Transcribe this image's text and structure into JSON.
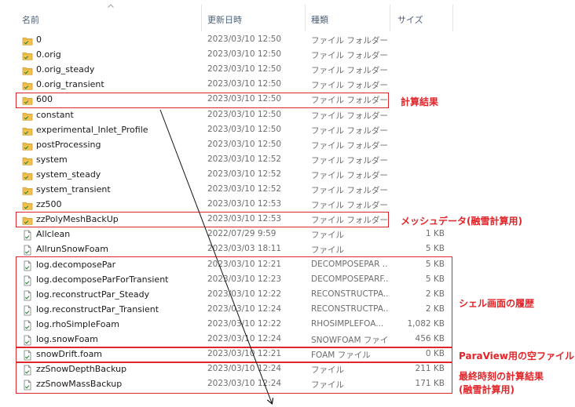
{
  "columns": {
    "name": "名前",
    "modified": "更新日時",
    "type": "種類",
    "size": "サイズ"
  },
  "rows": [
    {
      "icon": "folder-icon",
      "name": "0",
      "date": "2023/03/10 12:50",
      "type": "ファイル フォルダー",
      "size": ""
    },
    {
      "icon": "folder-icon",
      "name": "0.orig",
      "date": "2023/03/10 12:50",
      "type": "ファイル フォルダー",
      "size": ""
    },
    {
      "icon": "folder-icon",
      "name": "0.orig_steady",
      "date": "2023/03/10 12:50",
      "type": "ファイル フォルダー",
      "size": ""
    },
    {
      "icon": "folder-icon",
      "name": "0.orig_transient",
      "date": "2023/03/10 12:50",
      "type": "ファイル フォルダー",
      "size": ""
    },
    {
      "icon": "folder-icon",
      "name": "600",
      "date": "2023/03/10 12:50",
      "type": "ファイル フォルダー",
      "size": ""
    },
    {
      "icon": "folder-icon",
      "name": "constant",
      "date": "2023/03/10 12:50",
      "type": "ファイル フォルダー",
      "size": ""
    },
    {
      "icon": "folder-icon",
      "name": "experimental_Inlet_Profile",
      "date": "2023/03/10 12:50",
      "type": "ファイル フォルダー",
      "size": ""
    },
    {
      "icon": "folder-icon",
      "name": "postProcessing",
      "date": "2023/03/10 12:50",
      "type": "ファイル フォルダー",
      "size": ""
    },
    {
      "icon": "folder-icon",
      "name": "system",
      "date": "2023/03/10 12:52",
      "type": "ファイル フォルダー",
      "size": ""
    },
    {
      "icon": "folder-icon",
      "name": "system_steady",
      "date": "2023/03/10 12:52",
      "type": "ファイル フォルダー",
      "size": ""
    },
    {
      "icon": "folder-icon",
      "name": "system_transient",
      "date": "2023/03/10 12:52",
      "type": "ファイル フォルダー",
      "size": ""
    },
    {
      "icon": "folder-icon",
      "name": "zz500",
      "date": "2023/03/10 12:53",
      "type": "ファイル フォルダー",
      "size": ""
    },
    {
      "icon": "folder-icon",
      "name": "zzPolyMeshBackUp",
      "date": "2023/03/10 12:53",
      "type": "ファイル フォルダー",
      "size": ""
    },
    {
      "icon": "file-icon",
      "name": "Allclean",
      "date": "2022/07/29 9:59",
      "type": "ファイル",
      "size": "1 KB"
    },
    {
      "icon": "file-icon",
      "name": "AllrunSnowFoam",
      "date": "2023/03/03 18:11",
      "type": "ファイル",
      "size": "5 KB"
    },
    {
      "icon": "file-icon",
      "name": "log.decomposePar",
      "date": "2023/03/10 12:21",
      "type": "DECOMPOSEPAR ...",
      "size": "5 KB"
    },
    {
      "icon": "file-icon",
      "name": "log.decomposeParForTransient",
      "date": "2023/03/10 12:23",
      "type": "DECOMPOSEPARF...",
      "size": "5 KB"
    },
    {
      "icon": "file-icon",
      "name": "log.reconstructPar_Steady",
      "date": "2023/03/10 12:22",
      "type": "RECONSTRUCTPA...",
      "size": "2 KB"
    },
    {
      "icon": "file-icon",
      "name": "log.reconstructPar_Transient",
      "date": "2023/03/10 12:24",
      "type": "RECONSTRUCTPA...",
      "size": "2 KB"
    },
    {
      "icon": "file-icon",
      "name": "log.rhoSimpleFoam",
      "date": "2023/03/10 12:22",
      "type": "RHOSIMPLEFOA...",
      "size": "1,082 KB"
    },
    {
      "icon": "file-icon",
      "name": "log.snowFoam",
      "date": "2023/03/10 12:24",
      "type": "SNOWFOAM ファイル",
      "size": "456 KB"
    },
    {
      "icon": "file-icon",
      "name": "snowDrift.foam",
      "date": "2023/03/10 12:21",
      "type": "FOAM ファイル",
      "size": "0 KB"
    },
    {
      "icon": "file-icon",
      "name": "zzSnowDepthBackup",
      "date": "2023/03/10 12:24",
      "type": "ファイル",
      "size": "211 KB"
    },
    {
      "icon": "file-icon",
      "name": "zzSnowMassBackup",
      "date": "2023/03/10 12:24",
      "type": "ファイル",
      "size": "171 KB"
    }
  ],
  "annotations": {
    "calc_result": "計算結果",
    "mesh_data": "メッシュデータ(融雪計算用)",
    "shell_history": "シェル画面の履歴",
    "paraview_empty": "ParaView用の空ファイル",
    "final_result_line1": "最終時刻の計算結果",
    "final_result_line2": "(融雪計算用)"
  },
  "colors": {
    "annotation_red": "#e0262a",
    "folder_yellow": "#f2c14e",
    "header_text": "#4c607a"
  }
}
